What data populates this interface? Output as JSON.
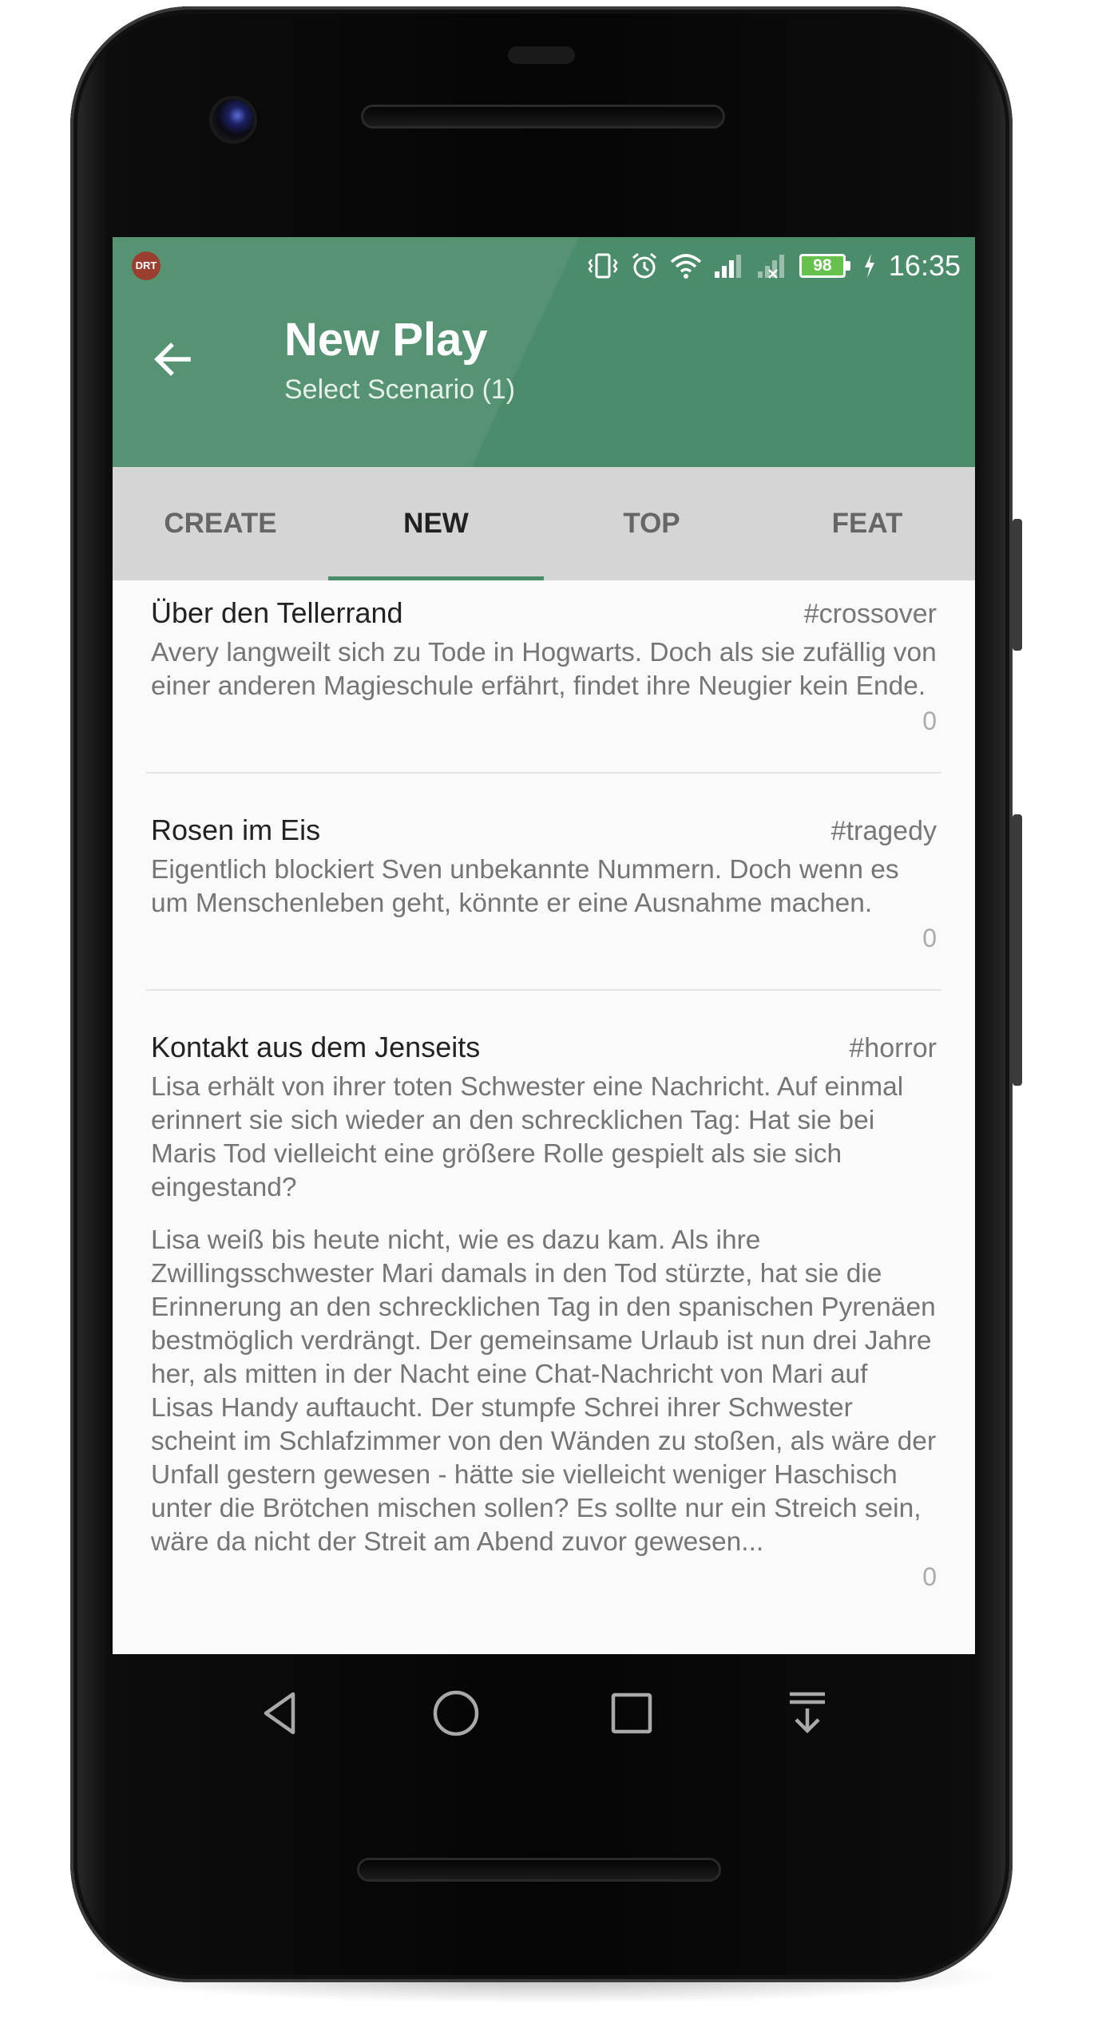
{
  "status_bar": {
    "app_logo": "DRT",
    "battery": "98",
    "time": "16:35"
  },
  "app_bar": {
    "title": "New Play",
    "subtitle": "Select Scenario (1)",
    "back_icon": "arrow-left-icon",
    "color": "#4b8c6a"
  },
  "tabs": [
    {
      "label": "CREATE",
      "active": false
    },
    {
      "label": "NEW",
      "active": true
    },
    {
      "label": "TOP",
      "active": false
    },
    {
      "label": "FEAT",
      "active": false
    }
  ],
  "scenarios": [
    {
      "title": "Über den Tellerrand",
      "tag": "#crossover",
      "description": "Avery langweilt sich zu Tode in Hogwarts. Doch als sie zufällig von einer anderen Magieschule erfährt, findet ihre Neugier kein Ende.",
      "count": "0"
    },
    {
      "title": "Rosen im Eis",
      "tag": "#tragedy",
      "description": "Eigentlich blockiert Sven unbekannte Nummern. Doch wenn es um Menschenleben geht, könnte er eine Ausnahme machen.",
      "count": "0"
    },
    {
      "title": "Kontakt aus dem Jenseits",
      "tag": "#horror",
      "description": "Lisa erhält von ihrer toten Schwester eine Nachricht. Auf einmal erinnert sie sich wieder an den schrecklichen Tag: Hat sie bei Maris Tod vielleicht eine größere Rolle gespielt als sie sich eingestand?",
      "long_text": "Lisa weiß bis heute nicht, wie es dazu kam. Als ihre Zwillingsschwester Mari damals in den Tod stürzte, hat sie die Erinnerung an den schrecklichen Tag in den spanischen Pyrenäen bestmöglich verdrängt. Der gemeinsame Urlaub ist nun drei Jahre her, als mitten in der Nacht eine Chat-Nachricht von Mari auf Lisas Handy auftaucht. Der stumpfe Schrei ihrer Schwester scheint im Schlafzimmer von den Wänden zu stoßen, als wäre der Unfall gestern gewesen - hätte sie vielleicht weniger Haschisch unter die Brötchen mischen sollen? Es sollte nur ein Streich sein, wäre da nicht der Streit am Abend zuvor gewesen...",
      "count": "0"
    }
  ],
  "nav_bar": {
    "buttons": [
      "back-triangle-icon",
      "home-circle-icon",
      "recents-square-icon",
      "notification-pull-down-icon"
    ]
  }
}
